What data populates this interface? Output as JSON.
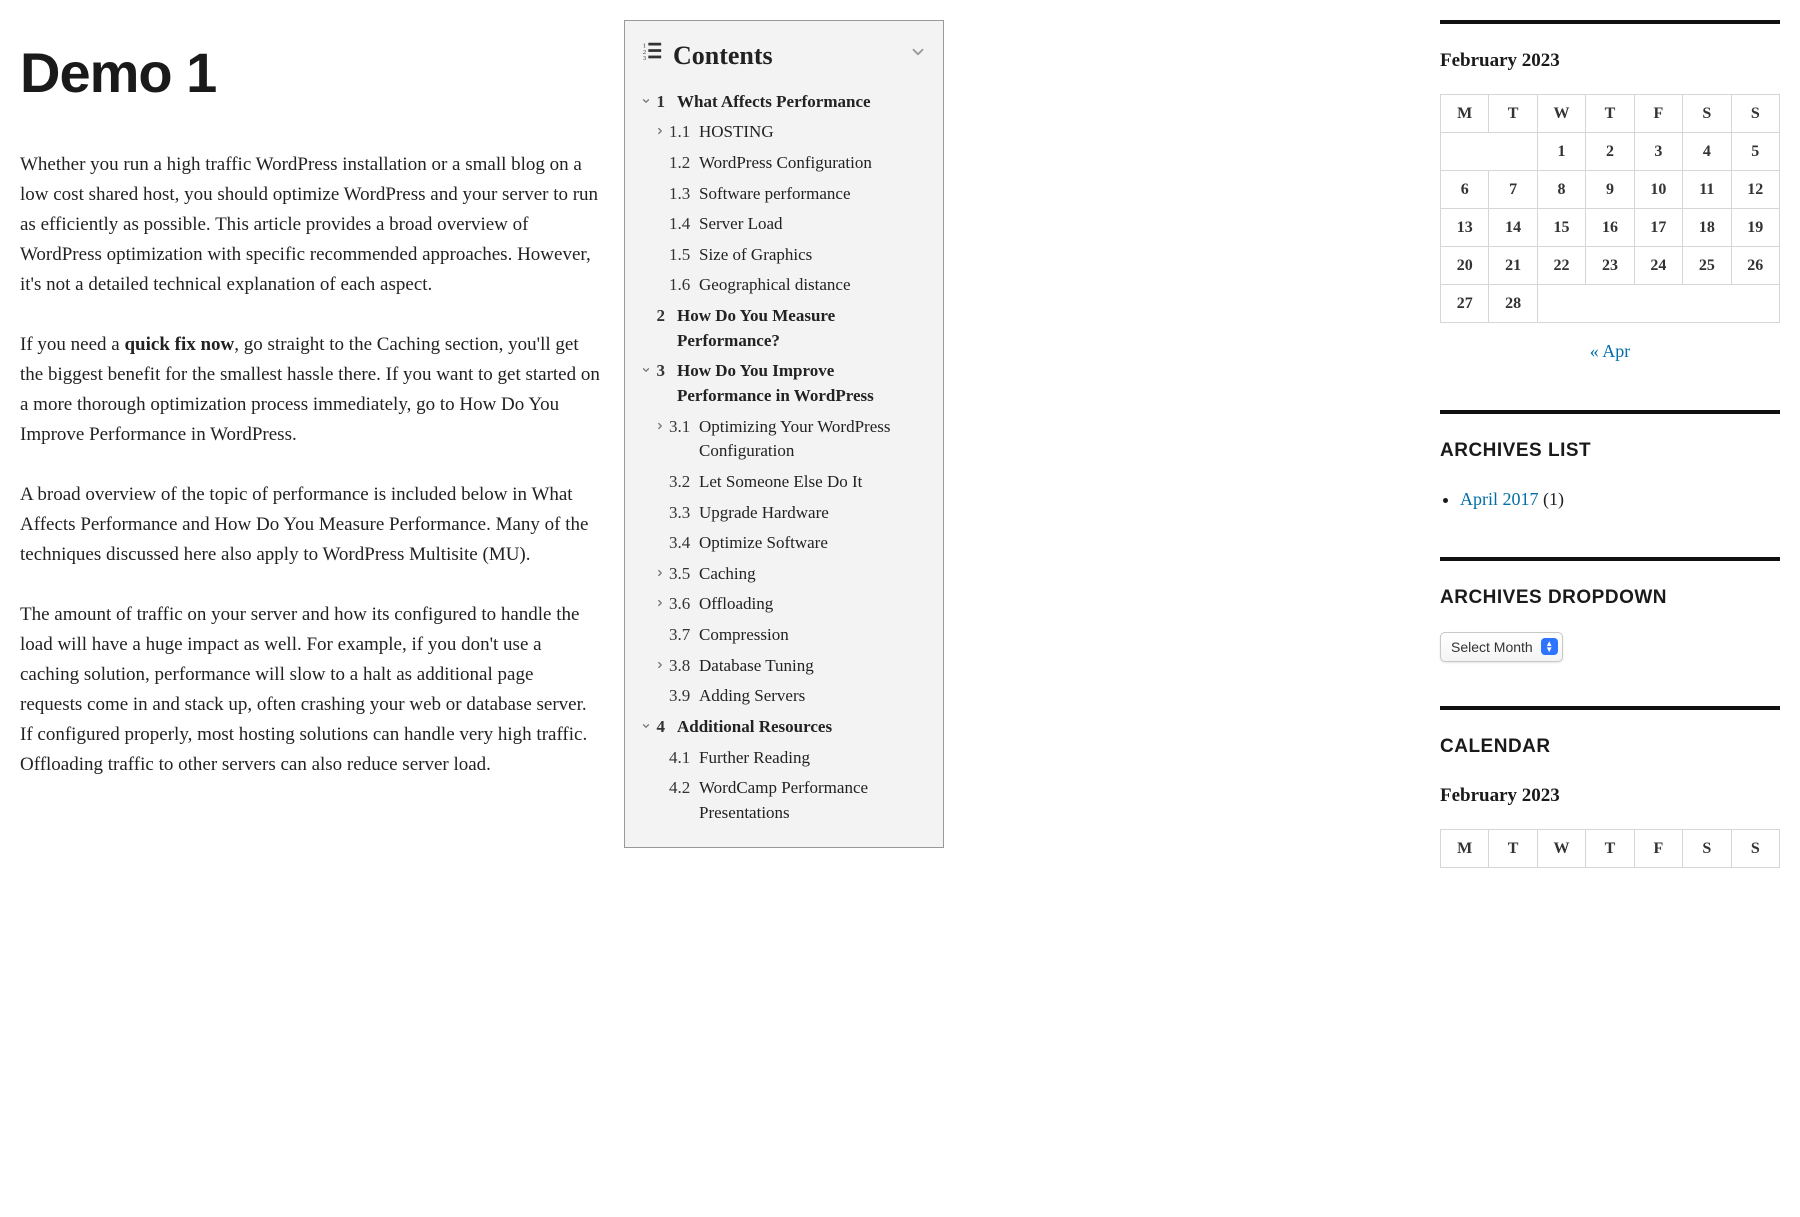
{
  "page_title": "Demo 1",
  "paragraphs": [
    {
      "parts": [
        {
          "t": "Whether you run a high traffic WordPress installation or a small blog on a low cost shared host, you should optimize WordPress and your server to run as efficiently as possible. This article provides a broad overview of WordPress optimization with specific recommended approaches. However, it's not a detailed technical explanation of each aspect.",
          "b": false
        }
      ]
    },
    {
      "parts": [
        {
          "t": "If you need a ",
          "b": false
        },
        {
          "t": "quick fix now",
          "b": true
        },
        {
          "t": ", go straight to the Caching section, you'll get the biggest benefit for the smallest hassle there. If you want to get started on a more thorough optimization process immediately, go to How Do You Improve Performance in WordPress.",
          "b": false
        }
      ]
    },
    {
      "parts": [
        {
          "t": "A broad overview of the topic of performance is included below in What Affects Performance and How Do You Measure Performance. Many of the techniques discussed here also apply to WordPress Multisite (MU).",
          "b": false
        }
      ]
    },
    {
      "parts": [
        {
          "t": "The amount of traffic on your server and how its configured to handle the load will have a huge impact as well. For example, if you don't use a caching solution, performance will slow to a halt as additional page requests come in and stack up, often crashing your web or database server. If configured properly, most hosting solutions can handle very high traffic. Offloading traffic to other servers can also reduce server load.",
          "b": false
        }
      ]
    }
  ],
  "toc": {
    "title": "Contents",
    "items": [
      {
        "level": 1,
        "arrow": "down",
        "num": "1",
        "label": "What Affects Performance"
      },
      {
        "level": 2,
        "arrow": "right",
        "num": "1.1",
        "label": "HOSTING"
      },
      {
        "level": 2,
        "arrow": "",
        "num": "1.2",
        "label": "WordPress Configuration"
      },
      {
        "level": 2,
        "arrow": "",
        "num": "1.3",
        "label": "Software performance"
      },
      {
        "level": 2,
        "arrow": "",
        "num": "1.4",
        "label": "Server Load"
      },
      {
        "level": 2,
        "arrow": "",
        "num": "1.5",
        "label": "Size of Graphics"
      },
      {
        "level": 2,
        "arrow": "",
        "num": "1.6",
        "label": "Geographical distance"
      },
      {
        "level": 1,
        "arrow": "",
        "num": "2",
        "label": "How Do You Measure Performance?"
      },
      {
        "level": 1,
        "arrow": "down",
        "num": "3",
        "label": "How Do You Improve Performance in WordPress"
      },
      {
        "level": 2,
        "arrow": "right",
        "num": "3.1",
        "label": "Optimizing Your WordPress Configuration"
      },
      {
        "level": 2,
        "arrow": "",
        "num": "3.2",
        "label": "Let Someone Else Do It"
      },
      {
        "level": 2,
        "arrow": "",
        "num": "3.3",
        "label": "Upgrade Hardware"
      },
      {
        "level": 2,
        "arrow": "",
        "num": "3.4",
        "label": "Optimize Software"
      },
      {
        "level": 2,
        "arrow": "right",
        "num": "3.5",
        "label": "Caching"
      },
      {
        "level": 2,
        "arrow": "right",
        "num": "3.6",
        "label": "Offloading"
      },
      {
        "level": 2,
        "arrow": "",
        "num": "3.7",
        "label": "Compression"
      },
      {
        "level": 2,
        "arrow": "right",
        "num": "3.8",
        "label": "Database Tuning"
      },
      {
        "level": 2,
        "arrow": "",
        "num": "3.9",
        "label": "Adding Servers"
      },
      {
        "level": 1,
        "arrow": "down",
        "num": "4",
        "label": "Additional Resources"
      },
      {
        "level": 2,
        "arrow": "",
        "num": "4.1",
        "label": "Further Reading"
      },
      {
        "level": 2,
        "arrow": "",
        "num": "4.2",
        "label": "WordCamp Performance Presentations"
      }
    ]
  },
  "calendar": {
    "caption": "February 2023",
    "weekdays": [
      "M",
      "T",
      "W",
      "T",
      "F",
      "S",
      "S"
    ],
    "weeks": [
      [
        "",
        "",
        "1",
        "2",
        "3",
        "4",
        "5"
      ],
      [
        "6",
        "7",
        "8",
        "9",
        "10",
        "11",
        "12"
      ],
      [
        "13",
        "14",
        "15",
        "16",
        "17",
        "18",
        "19"
      ],
      [
        "20",
        "21",
        "22",
        "23",
        "24",
        "25",
        "26"
      ],
      [
        "27",
        "28",
        "",
        "",
        "",
        "",
        ""
      ]
    ],
    "prev_link": "« Apr"
  },
  "archives_list": {
    "title": "ARCHIVES LIST",
    "items": [
      {
        "label": "April 2017",
        "count": "(1)"
      }
    ]
  },
  "archives_dropdown": {
    "title": "ARCHIVES DROPDOWN",
    "selected": "Select Month"
  },
  "calendar2": {
    "title": "CALENDAR",
    "caption": "February 2023",
    "weekdays": [
      "M",
      "T",
      "W",
      "T",
      "F",
      "S",
      "S"
    ]
  }
}
